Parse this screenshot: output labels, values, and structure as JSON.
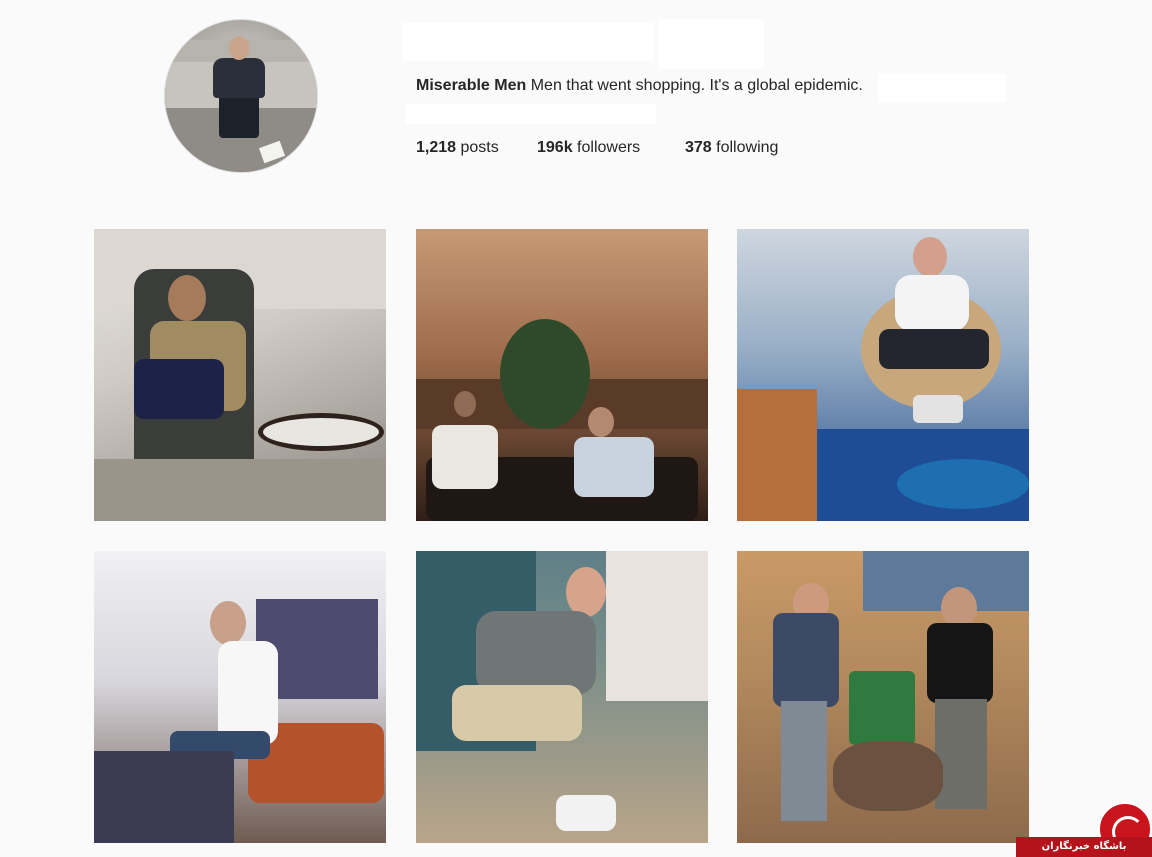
{
  "profile": {
    "name": "Miserable Men",
    "bio": "Men that went shopping. It's a global epidemic."
  },
  "stats": {
    "posts_count": "1,218",
    "posts_label": "posts",
    "followers_count": "196k",
    "followers_label": "followers",
    "following_count": "378",
    "following_label": "following"
  },
  "posts": [
    {
      "id": "post-1"
    },
    {
      "id": "post-2"
    },
    {
      "id": "post-3"
    },
    {
      "id": "post-4"
    },
    {
      "id": "post-5"
    },
    {
      "id": "post-6"
    }
  ],
  "watermark": {
    "text": "باشگاه خبرنگاران"
  },
  "colors": {
    "background": "#fafafa",
    "text": "#262626",
    "watermark_red": "#b5131b"
  }
}
